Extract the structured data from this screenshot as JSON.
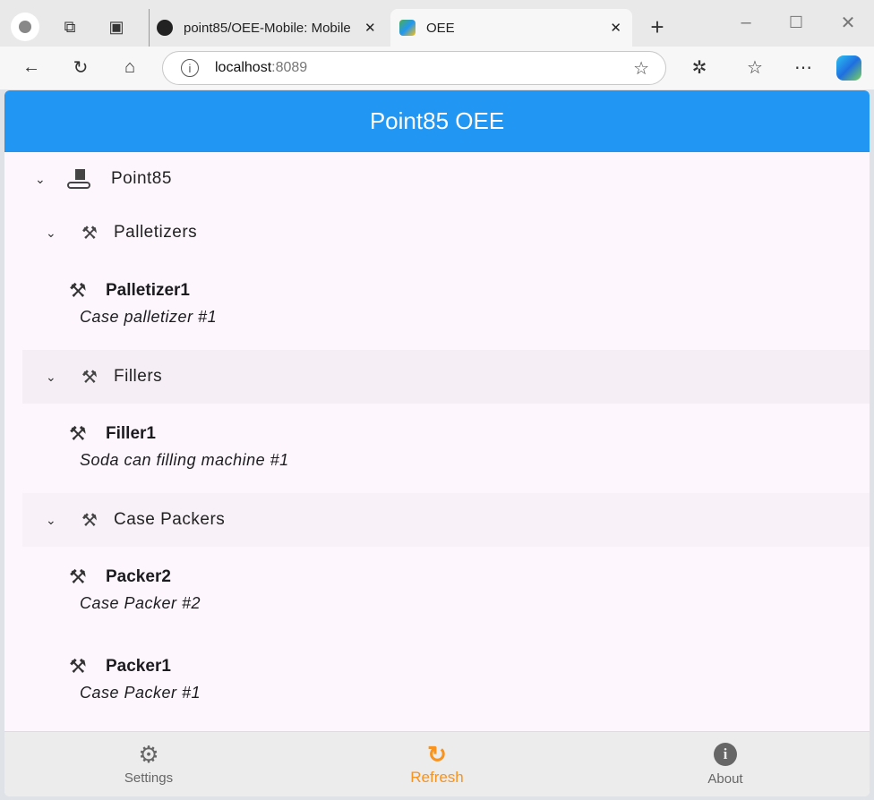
{
  "browser": {
    "tabs": [
      {
        "title": "point85/OEE-Mobile: Mobile",
        "icon": "github-icon"
      },
      {
        "title": "OEE",
        "icon": "oee-favicon",
        "active": true
      }
    ],
    "url_host": "localhost",
    "url_port": ":8089"
  },
  "app": {
    "title": "Point85 OEE",
    "tree": [
      {
        "label": "Point85",
        "icon": "enterprise-icon"
      },
      {
        "label": "Palletizers",
        "icon": "robot-arm-icon"
      },
      {
        "label": "Fillers",
        "icon": "robot-arm-icon"
      },
      {
        "label": "Case Packers",
        "icon": "robot-arm-icon"
      }
    ],
    "equipment": [
      {
        "name": "Palletizer1",
        "description": "Case palletizer #1"
      },
      {
        "name": "Filler1",
        "description": "Soda can filling machine #1"
      },
      {
        "name": "Packer2",
        "description": "Case Packer #2"
      },
      {
        "name": "Packer1",
        "description": "Case Packer #1"
      }
    ],
    "nav": [
      {
        "label": "Settings",
        "icon": "gear-icon"
      },
      {
        "label": "Refresh",
        "icon": "refresh-icon",
        "active": true
      },
      {
        "label": "About",
        "icon": "info-icon"
      }
    ],
    "colors": {
      "header": "#2196f3",
      "active_nav": "#f7931e"
    }
  }
}
